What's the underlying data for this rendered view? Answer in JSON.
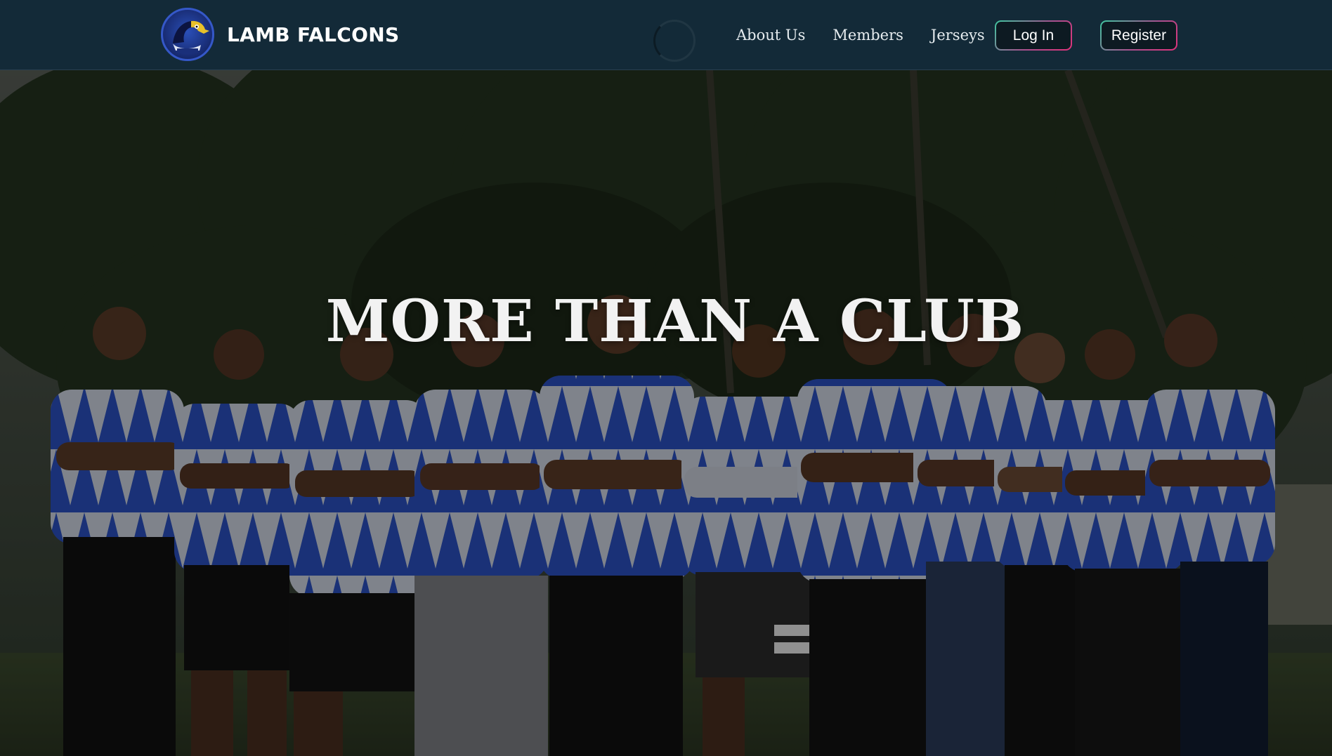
{
  "brand": {
    "name": "LAMB FALCONS",
    "logo_icon": "falcon-logo-icon"
  },
  "nav": {
    "links": [
      {
        "label": "About Us"
      },
      {
        "label": "Members"
      },
      {
        "label": "Jerseys"
      }
    ],
    "login_label": "Log In",
    "register_label": "Register"
  },
  "hero": {
    "title": "MORE THAN A CLUB",
    "image": "team-photo",
    "player_count": 11
  },
  "colors": {
    "navbar": "#132a38",
    "jersey_blue": "#2a4fc0",
    "jersey_white": "#d8dde8",
    "button_gradient_start": "#3ec7a0",
    "button_gradient_end": "#e0327a"
  }
}
